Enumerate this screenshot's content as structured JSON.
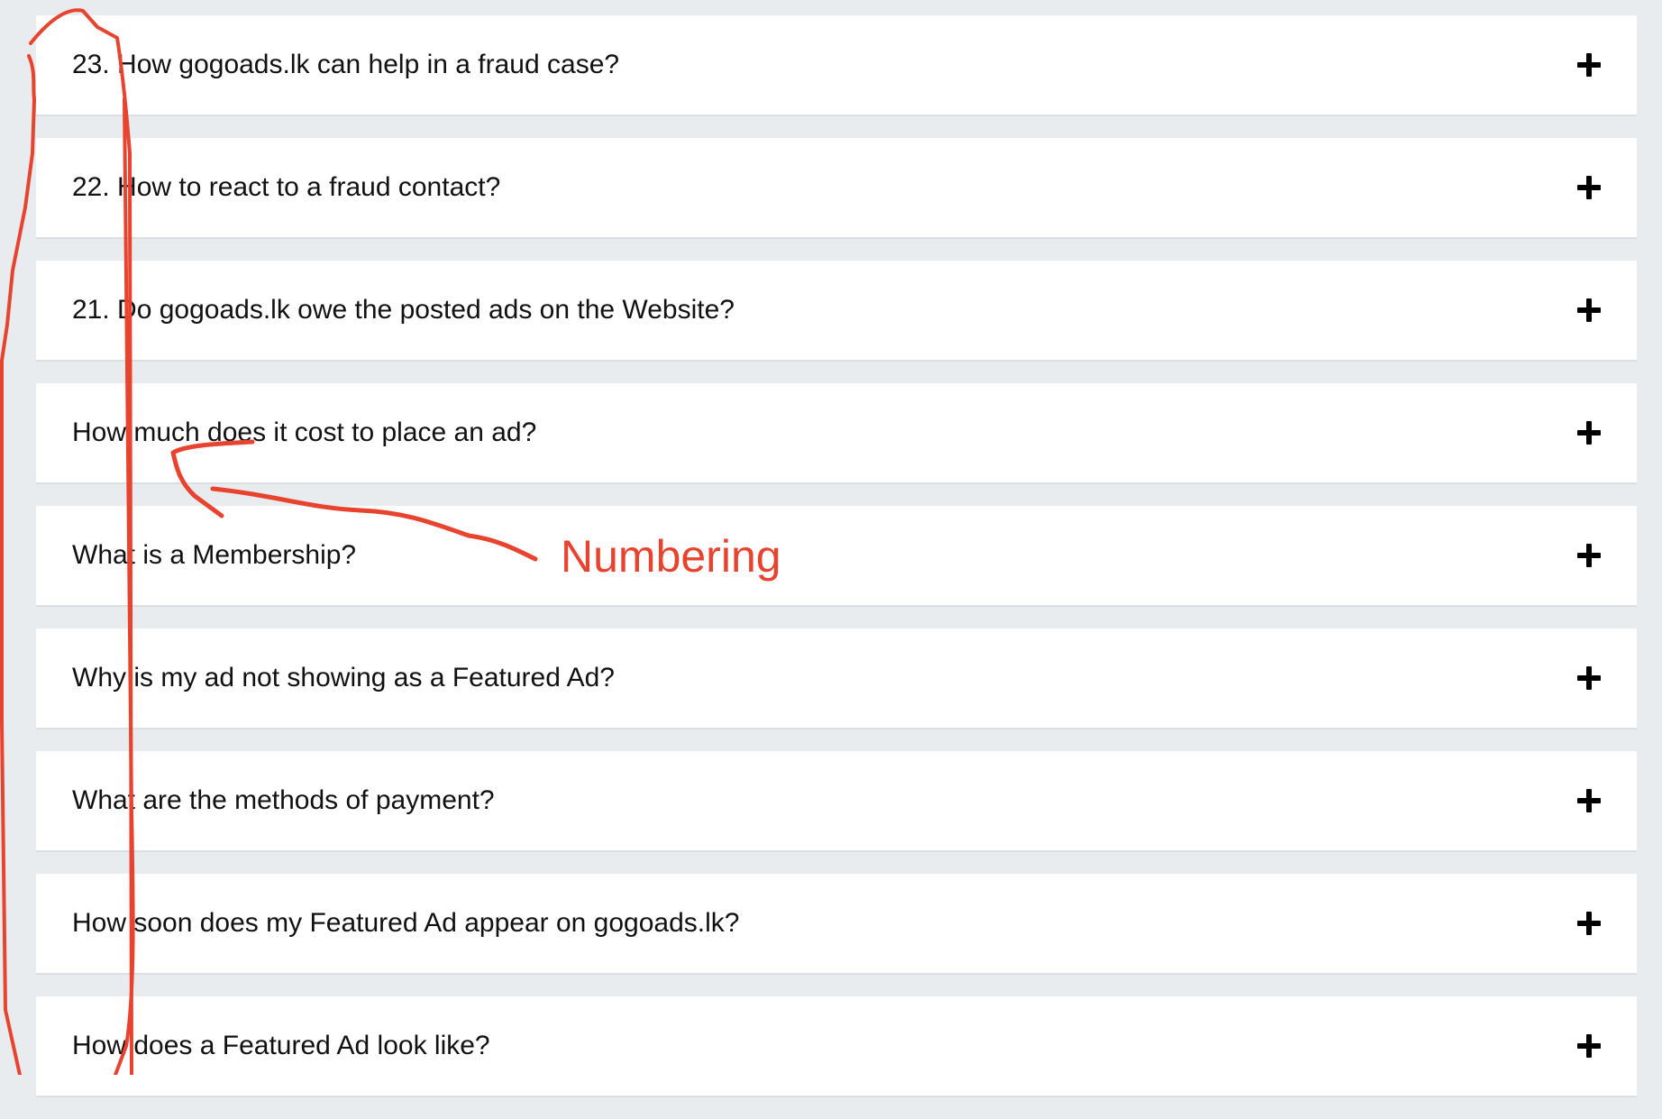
{
  "faq": {
    "items": [
      {
        "question": "23. How gogoads.lk can help in a fraud case?"
      },
      {
        "question": "22. How to react to a fraud contact?"
      },
      {
        "question": "21. Do gogoads.lk owe the posted ads on the Website?"
      },
      {
        "question": "How much does it cost to place an ad?"
      },
      {
        "question": "What is a Membership?"
      },
      {
        "question": "Why is my ad not showing as a Featured Ad?"
      },
      {
        "question": "What are the methods of payment?"
      },
      {
        "question": "How soon does my Featured Ad appear on gogoads.lk?"
      },
      {
        "question": "How does a Featured Ad look like?"
      }
    ],
    "expand_icon": "plus-icon"
  },
  "annotation": {
    "label": "Numbering",
    "color": "#e8432f"
  }
}
